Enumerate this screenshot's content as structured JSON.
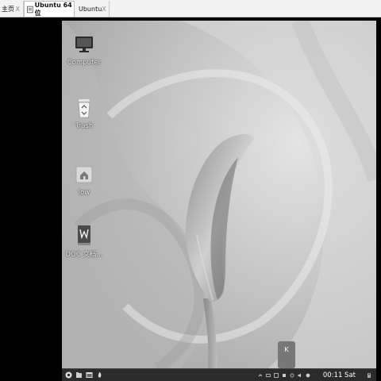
{
  "host_tabs": [
    {
      "label": "主页",
      "close": "X"
    },
    {
      "label": "Ubuntu 64 位",
      "close": "X"
    },
    {
      "label": "Ubuntu",
      "close": "X"
    }
  ],
  "desktop_icons": [
    {
      "label": "Computer",
      "icon": "computer-icon"
    },
    {
      "label": "Trash",
      "icon": "trash-icon"
    },
    {
      "label": "low",
      "icon": "home-folder-icon"
    },
    {
      "label": "DOC 文档...",
      "icon": "document-icon"
    }
  ],
  "widget": {
    "label": "K"
  },
  "taskbar": {
    "clock": "00:11 Sat",
    "launchers": [
      "start-menu-icon",
      "files-icon",
      "terminal-icon",
      "settings-icon"
    ],
    "tray": [
      "chevron-up-icon",
      "keyboard-icon",
      "network-icon",
      "display-icon",
      "sync-icon",
      "volume-icon",
      "app-status-icon",
      "battery-icon"
    ]
  },
  "colors": {
    "tabbar": "#f2f2f2",
    "taskbar": "#2b2b2b",
    "wallpaper": "#cfcfcf"
  }
}
